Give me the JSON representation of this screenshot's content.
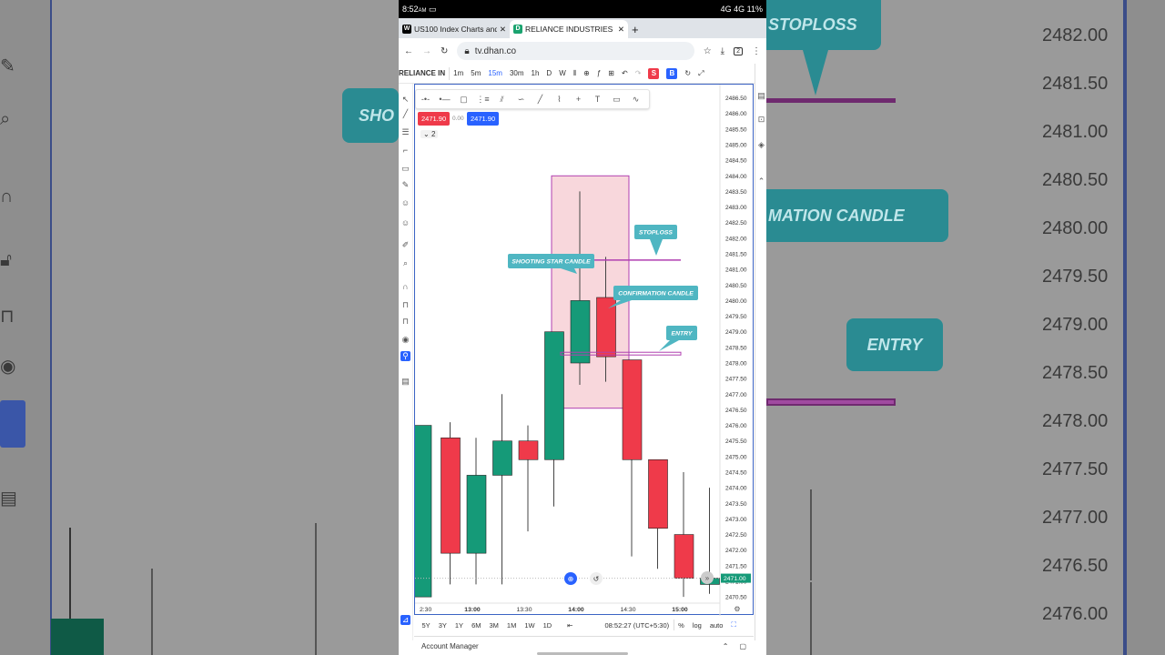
{
  "status_bar": {
    "time": "8:52",
    "ampm": "AM",
    "right": "4G 4G 11%"
  },
  "tabs": [
    {
      "label": "US100 Index Charts and",
      "favicon": "W",
      "favicon_color": "#000000"
    },
    {
      "label": "RELIANCE INDUSTRIES L",
      "favicon": "D",
      "favicon_color": "#1aa36f"
    }
  ],
  "url": "tv.dhan.co",
  "toolbar": {
    "symbol": "RELIANCE IN",
    "intervals": [
      "1m",
      "5m",
      "15m",
      "30m",
      "1h",
      "D",
      "W"
    ],
    "selected_interval": "15m",
    "sell_label": "S",
    "buy_label": "B"
  },
  "chart": {
    "sell_price": "2471.90",
    "spread": "0.00",
    "buy_price": "2471.90",
    "indicator_count": "2",
    "last_price_label": "2471.00",
    "annotations": {
      "stoploss": "STOPLOSS",
      "shooting_star": "SHOOTING STAR CANDLE",
      "confirmation": "CONFIRMATION CANDLE",
      "entry": "ENTRY"
    },
    "bull_color": "#159a78",
    "bear_color": "#ef3a4a",
    "annotation_color": "#4fb6c2",
    "line_color": "#b03fb0"
  },
  "chart_data": {
    "type": "candlestick",
    "y_ticks": [
      "2486.50",
      "2486.00",
      "2485.50",
      "2485.00",
      "2484.50",
      "2484.00",
      "2483.50",
      "2483.00",
      "2482.50",
      "2482.00",
      "2481.50",
      "2481.00",
      "2480.50",
      "2480.00",
      "2479.50",
      "2479.00",
      "2478.50",
      "2478.00",
      "2477.50",
      "2477.00",
      "2476.50",
      "2476.00",
      "2475.50",
      "2475.00",
      "2474.50",
      "2474.00",
      "2473.50",
      "2473.00",
      "2472.50",
      "2472.00",
      "2471.50",
      "2471.00",
      "2470.50"
    ],
    "x_ticks": [
      "2:30",
      "13:00",
      "13:30",
      "14:00",
      "14:30",
      "15:00"
    ],
    "ylim": [
      2470.3,
      2486.75
    ],
    "candles": [
      {
        "o": 2470.5,
        "h": 2476.0,
        "l": 2470.5,
        "c": 2476.0,
        "dir": "up"
      },
      {
        "o": 2475.6,
        "h": 2476.1,
        "l": 2470.9,
        "c": 2471.9,
        "dir": "down"
      },
      {
        "o": 2471.9,
        "h": 2475.6,
        "l": 2470.9,
        "c": 2474.4,
        "dir": "up"
      },
      {
        "o": 2474.4,
        "h": 2477.0,
        "l": 2470.9,
        "c": 2475.5,
        "dir": "up"
      },
      {
        "o": 2475.5,
        "h": 2476.0,
        "l": 2472.6,
        "c": 2474.9,
        "dir": "down"
      },
      {
        "o": 2474.9,
        "h": 2479.0,
        "l": 2473.4,
        "c": 2479.0,
        "dir": "up"
      },
      {
        "o": 2478.0,
        "h": 2483.5,
        "l": 2477.3,
        "c": 2480.0,
        "dir": "up"
      },
      {
        "o": 2480.1,
        "h": 2481.4,
        "l": 2477.4,
        "c": 2478.2,
        "dir": "down"
      },
      {
        "o": 2478.1,
        "h": 2478.1,
        "l": 2471.8,
        "c": 2474.9,
        "dir": "down"
      },
      {
        "o": 2474.9,
        "h": 2474.9,
        "l": 2471.4,
        "c": 2472.7,
        "dir": "down"
      },
      {
        "o": 2472.5,
        "h": 2474.5,
        "l": 2470.5,
        "c": 2471.1,
        "dir": "down"
      },
      {
        "o": 2470.9,
        "h": 2474.0,
        "l": 2470.6,
        "c": 2471.1,
        "dir": "up"
      }
    ],
    "stoploss": 2481.3,
    "entry": 2478.3,
    "highlight_box": [
      2476.55,
      2484.0
    ]
  },
  "bottom_bar": {
    "ranges": [
      "5Y",
      "3Y",
      "1Y",
      "6M",
      "3M",
      "1M",
      "1W",
      "1D"
    ],
    "clock": "08:52:27 (UTC+5:30)",
    "percent": "%",
    "log": "log",
    "auto": "auto"
  },
  "account_manager": "Account Manager",
  "bg_right_prices": [
    "2482.00",
    "2481.50",
    "2481.00",
    "2480.50",
    "2480.00",
    "2479.50",
    "2479.00",
    "2478.50",
    "2478.00",
    "2477.50",
    "2477.00",
    "2476.50",
    "2476.00"
  ],
  "bg_right_labels": {
    "stoploss": "STOPLOSS",
    "confirmation": "MATION CANDLE",
    "entry": "ENTRY"
  },
  "bg_left_label": "SHO"
}
